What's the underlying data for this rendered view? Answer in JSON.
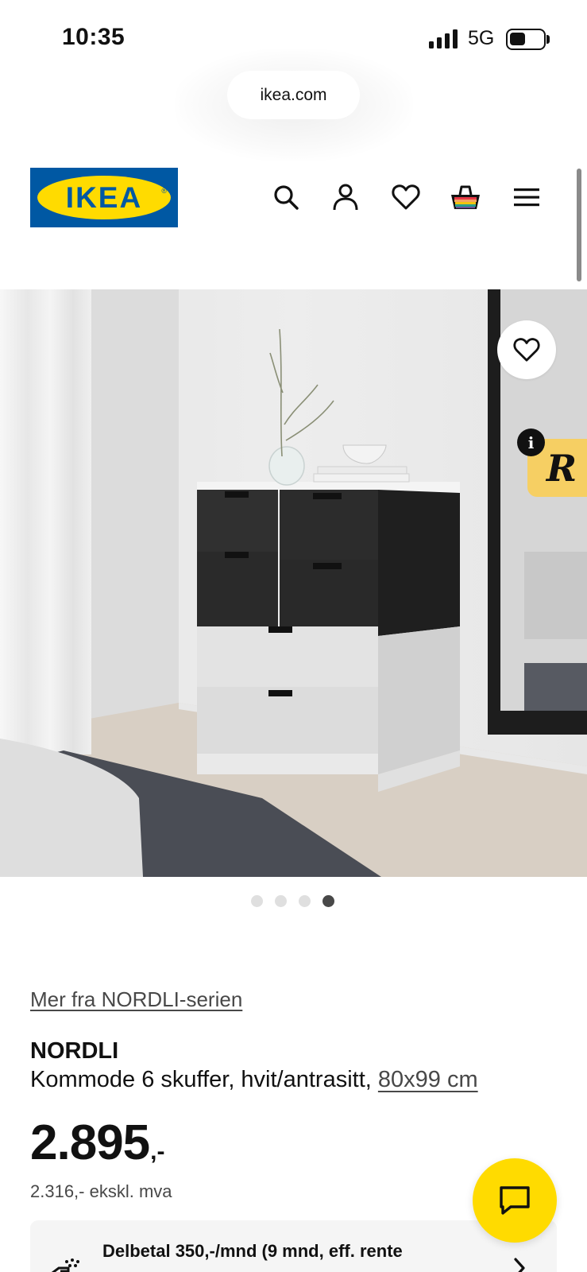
{
  "status_bar": {
    "time": "10:35",
    "network": "5G"
  },
  "browser": {
    "url": "ikea.com"
  },
  "header": {
    "logo_text": "IKEA",
    "logo_registered": "®",
    "icons": [
      "search-icon",
      "account-icon",
      "wishlist-heart-icon",
      "shopping-bag-icon",
      "menu-icon"
    ],
    "brand_colors": {
      "blue": "#0058a3",
      "yellow": "#ffdb00"
    }
  },
  "gallery": {
    "image_count": 4,
    "active_index": 3,
    "favorite_icon": "heart-icon",
    "overlay_badge_letter": "R",
    "overlay_info_letter": "i"
  },
  "product": {
    "series_link": "Mer fra NORDLI-serien",
    "name": "NORDLI",
    "description": "Kommode 6 skuffer, hvit/antrasitt, ",
    "size_link": "80x99 cm",
    "price_main": "2.895",
    "price_suffix": ",-",
    "price_ex_vat": "2.316,- ekskl. mva"
  },
  "finance": {
    "text": "Delbetal 350,-/mnd (9 mnd, eff. rente"
  },
  "chat": {
    "icon": "chat-bubble-icon"
  }
}
